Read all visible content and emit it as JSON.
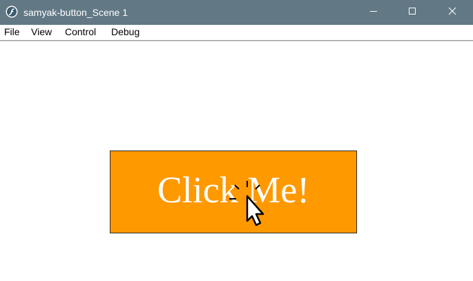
{
  "window": {
    "title": "samyak-button_Scene 1",
    "controls": {
      "minimize": "minimize-icon",
      "maximize": "maximize-icon",
      "close": "close-icon"
    }
  },
  "menu": {
    "items": [
      {
        "label": "File"
      },
      {
        "label": "View"
      },
      {
        "label": "Control"
      },
      {
        "label": "Debug"
      }
    ]
  },
  "stage": {
    "button": {
      "label": "Click Me!",
      "background_color": "#ff9900",
      "text_color": "#ffffff"
    },
    "cursor": "hand-click-cursor-icon"
  },
  "colors": {
    "titlebar": "#627985",
    "stage_background": "#ffffff"
  }
}
